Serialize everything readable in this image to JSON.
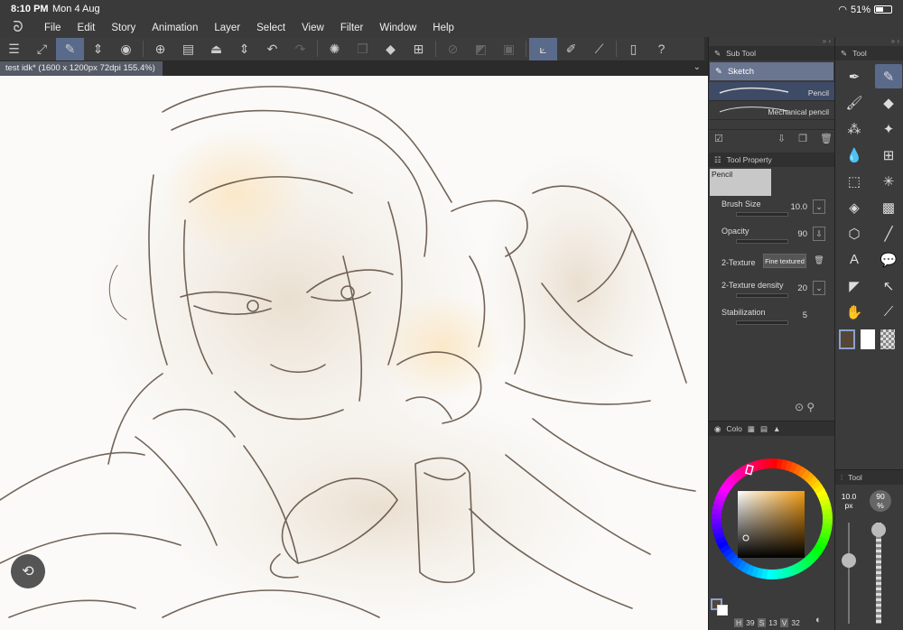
{
  "status": {
    "time": "8:10 PM",
    "date": "Mon 4 Aug",
    "battery": "51%",
    "battery_level": 0.51
  },
  "menu": [
    "File",
    "Edit",
    "Story",
    "Animation",
    "Layer",
    "Select",
    "View",
    "Filter",
    "Window",
    "Help"
  ],
  "document": {
    "tab_title": "test idk* (1600 x 1200px 72dpi 155.4%)"
  },
  "subtool": {
    "header": "Sub Tool",
    "group": "Sketch",
    "items": [
      "Pencil",
      "Mechanical pencil"
    ]
  },
  "tool_property": {
    "header": "Tool Property",
    "preview_label": "Pencil",
    "brush_size_label": "Brush Size",
    "brush_size": "10.0",
    "opacity_label": "Opacity",
    "opacity": "90",
    "texture_label": "2-Texture",
    "texture_value": "Fine textured",
    "texture_density_label": "2-Texture density",
    "texture_density": "20",
    "stabilization_label": "Stabilization",
    "stabilization": "5"
  },
  "tool_panel": {
    "header": "Tool"
  },
  "color_panel": {
    "tab": "Colo"
  },
  "brush_panel": {
    "header": "Tool",
    "size": "10.0",
    "size_unit": "px",
    "opacity": "90",
    "opacity_unit": "%"
  },
  "color_readout": {
    "h_label": "H",
    "h": "39",
    "s_label": "S",
    "s": "13",
    "v_label": "V",
    "v": "32"
  },
  "colors": {
    "accent": "#5a6a8a",
    "main_color": "#544735"
  }
}
